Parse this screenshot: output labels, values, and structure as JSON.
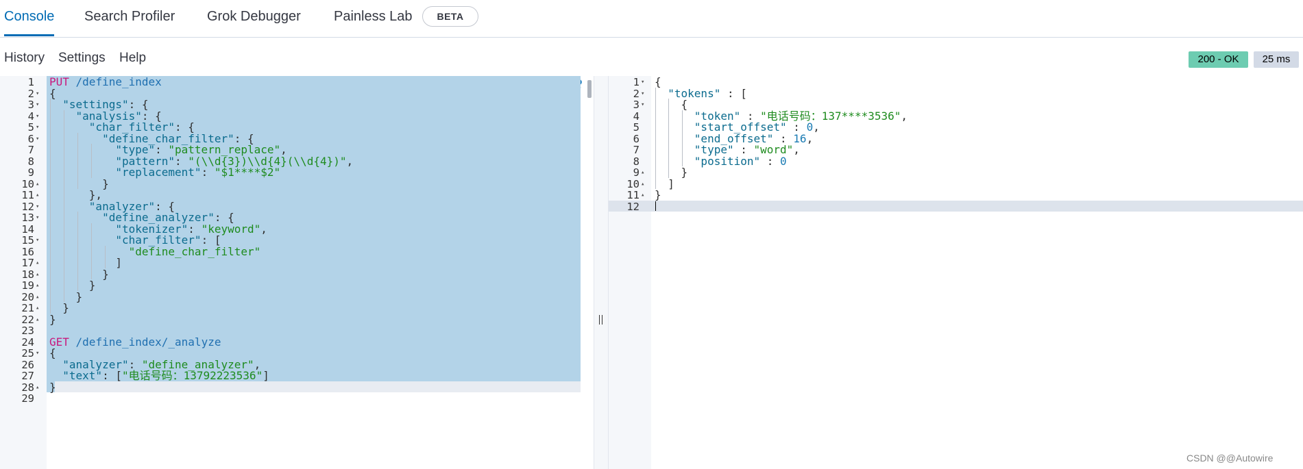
{
  "tabs": [
    {
      "label": "Console",
      "active": true
    },
    {
      "label": "Search Profiler"
    },
    {
      "label": "Grok Debugger"
    },
    {
      "label": "Painless Lab",
      "badge": "BETA"
    }
  ],
  "menu": [
    "History",
    "Settings",
    "Help"
  ],
  "response_status": "200 - OK",
  "response_time": "25 ms",
  "request_editor": {
    "lines": [
      [
        {
          "t": "PUT",
          "c": "m"
        },
        {
          "t": " /define_index",
          "c": "u"
        }
      ],
      [
        {
          "t": "{",
          "c": "p"
        }
      ],
      [
        {
          "t": "  \"settings\"",
          "c": "k"
        },
        {
          "t": ": {",
          "c": "p"
        }
      ],
      [
        {
          "t": "    \"analysis\"",
          "c": "k"
        },
        {
          "t": ": {",
          "c": "p"
        }
      ],
      [
        {
          "t": "      \"char_filter\"",
          "c": "k"
        },
        {
          "t": ": {",
          "c": "p"
        }
      ],
      [
        {
          "t": "        \"define_char_filter\"",
          "c": "k"
        },
        {
          "t": ": {",
          "c": "p"
        }
      ],
      [
        {
          "t": "          \"type\"",
          "c": "k"
        },
        {
          "t": ": ",
          "c": "p"
        },
        {
          "t": "\"pattern_replace\"",
          "c": "s"
        },
        {
          "t": ",",
          "c": "p"
        }
      ],
      [
        {
          "t": "          \"pattern\"",
          "c": "k"
        },
        {
          "t": ": ",
          "c": "p"
        },
        {
          "t": "\"(\\\\d{3})\\\\d{4}(\\\\d{4})\"",
          "c": "s"
        },
        {
          "t": ",",
          "c": "p"
        }
      ],
      [
        {
          "t": "          \"replacement\"",
          "c": "k"
        },
        {
          "t": ": ",
          "c": "p"
        },
        {
          "t": "\"$1****$2\"",
          "c": "s"
        }
      ],
      [
        {
          "t": "        }",
          "c": "p"
        }
      ],
      [
        {
          "t": "      },",
          "c": "p"
        }
      ],
      [
        {
          "t": "      \"analyzer\"",
          "c": "k"
        },
        {
          "t": ": {",
          "c": "p"
        }
      ],
      [
        {
          "t": "        \"define_analyzer\"",
          "c": "k"
        },
        {
          "t": ": {",
          "c": "p"
        }
      ],
      [
        {
          "t": "          \"tokenizer\"",
          "c": "k"
        },
        {
          "t": ": ",
          "c": "p"
        },
        {
          "t": "\"keyword\"",
          "c": "s"
        },
        {
          "t": ",",
          "c": "p"
        }
      ],
      [
        {
          "t": "          \"char_filter\"",
          "c": "k"
        },
        {
          "t": ": [",
          "c": "p"
        }
      ],
      [
        {
          "t": "            \"define_char_filter\"",
          "c": "s"
        }
      ],
      [
        {
          "t": "          ]",
          "c": "p"
        }
      ],
      [
        {
          "t": "        }",
          "c": "p"
        }
      ],
      [
        {
          "t": "      }",
          "c": "p"
        }
      ],
      [
        {
          "t": "    }",
          "c": "p"
        }
      ],
      [
        {
          "t": "  }",
          "c": "p"
        }
      ],
      [
        {
          "t": "}",
          "c": "p"
        }
      ],
      [],
      [
        {
          "t": "GET",
          "c": "m"
        },
        {
          "t": " /define_index/_analyze",
          "c": "u"
        }
      ],
      [
        {
          "t": "{",
          "c": "p"
        }
      ],
      [
        {
          "t": "  \"analyzer\"",
          "c": "k"
        },
        {
          "t": ": ",
          "c": "p"
        },
        {
          "t": "\"define_analyzer\"",
          "c": "s"
        },
        {
          "t": ",",
          "c": "p"
        }
      ],
      [
        {
          "t": "  \"text\"",
          "c": "k"
        },
        {
          "t": ": [",
          "c": "p"
        },
        {
          "t": "\"电话号码：13792223536\"",
          "c": "s"
        },
        {
          "t": "]",
          "c": "p"
        }
      ],
      [
        {
          "t": "}",
          "c": "p"
        }
      ],
      []
    ],
    "fold_lines": {
      "2": "down",
      "3": "down",
      "4": "down",
      "5": "down",
      "6": "down",
      "10": "up",
      "11": "up",
      "12": "down",
      "13": "down",
      "15": "down",
      "17": "up",
      "18": "up",
      "19": "up",
      "20": "up",
      "21": "up",
      "22": "up",
      "25": "down",
      "28": "up"
    }
  },
  "response_editor": {
    "lines": [
      [
        {
          "t": "{",
          "c": "p"
        }
      ],
      [
        {
          "t": "  \"tokens\"",
          "c": "k"
        },
        {
          "t": " : [",
          "c": "p"
        }
      ],
      [
        {
          "t": "    {",
          "c": "p"
        }
      ],
      [
        {
          "t": "      \"token\"",
          "c": "k"
        },
        {
          "t": " : ",
          "c": "p"
        },
        {
          "t": "\"电话号码：137****3536\"",
          "c": "s"
        },
        {
          "t": ",",
          "c": "p"
        }
      ],
      [
        {
          "t": "      \"start_offset\"",
          "c": "k"
        },
        {
          "t": " : ",
          "c": "p"
        },
        {
          "t": "0",
          "c": "n"
        },
        {
          "t": ",",
          "c": "p"
        }
      ],
      [
        {
          "t": "      \"end_offset\"",
          "c": "k"
        },
        {
          "t": " : ",
          "c": "p"
        },
        {
          "t": "16",
          "c": "n"
        },
        {
          "t": ",",
          "c": "p"
        }
      ],
      [
        {
          "t": "      \"type\"",
          "c": "k"
        },
        {
          "t": " : ",
          "c": "p"
        },
        {
          "t": "\"word\"",
          "c": "s"
        },
        {
          "t": ",",
          "c": "p"
        }
      ],
      [
        {
          "t": "      \"position\"",
          "c": "k"
        },
        {
          "t": " : ",
          "c": "p"
        },
        {
          "t": "0",
          "c": "n"
        }
      ],
      [
        {
          "t": "    }",
          "c": "p"
        }
      ],
      [
        {
          "t": "  ]",
          "c": "p"
        }
      ],
      [
        {
          "t": "}",
          "c": "p"
        }
      ],
      []
    ],
    "fold_lines": {
      "1": "down",
      "2": "down",
      "3": "down",
      "9": "up",
      "10": "up",
      "11": "up"
    }
  },
  "watermark": "CSDN @@Autowire",
  "colors": {
    "accent": "#006bb4",
    "ok": "#6dccb1",
    "selection": "#b3d3e8",
    "method": "#c8197d",
    "string": "#1e8b1e",
    "key": "#0b6b8e"
  },
  "icons": [
    "play-icon",
    "wrench-icon",
    "resize-handle-icon"
  ]
}
